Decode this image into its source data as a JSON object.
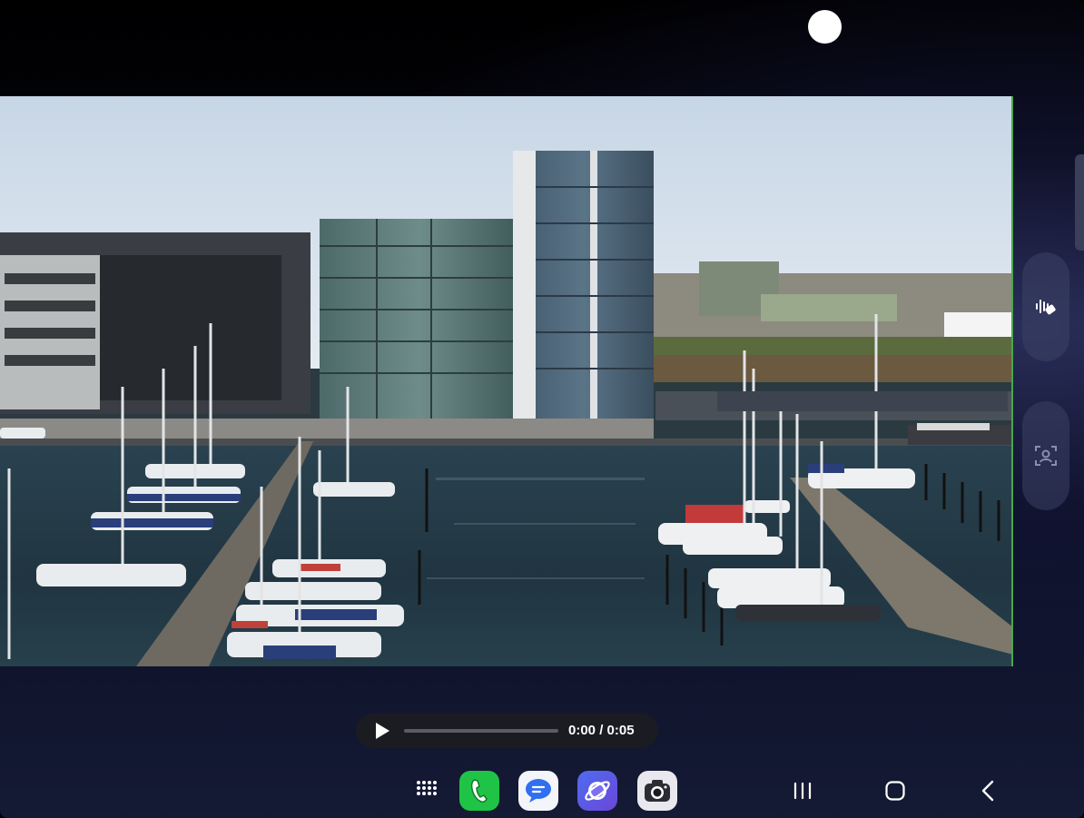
{
  "player": {
    "time_display": "0:00 / 0:05",
    "progress_fraction": 0.0
  },
  "icons": {
    "front_camera": "camera-cutout-icon",
    "edge_tool_1": "voice-eraser-icon",
    "edge_tool_2": "face-frame-icon",
    "play": "play-icon",
    "apps": "apps-grid-icon",
    "phone": "phone-icon",
    "messages": "messages-icon",
    "internet": "internet-icon",
    "camera": "camera-icon",
    "recents": "recents-icon",
    "home": "home-icon",
    "back": "back-icon"
  },
  "colors": {
    "phone_app": "#1fc447",
    "messages_app": "#2f6ff0",
    "internet_app": "#5a5ce8",
    "video_accent_edge": "#4aa84a"
  }
}
